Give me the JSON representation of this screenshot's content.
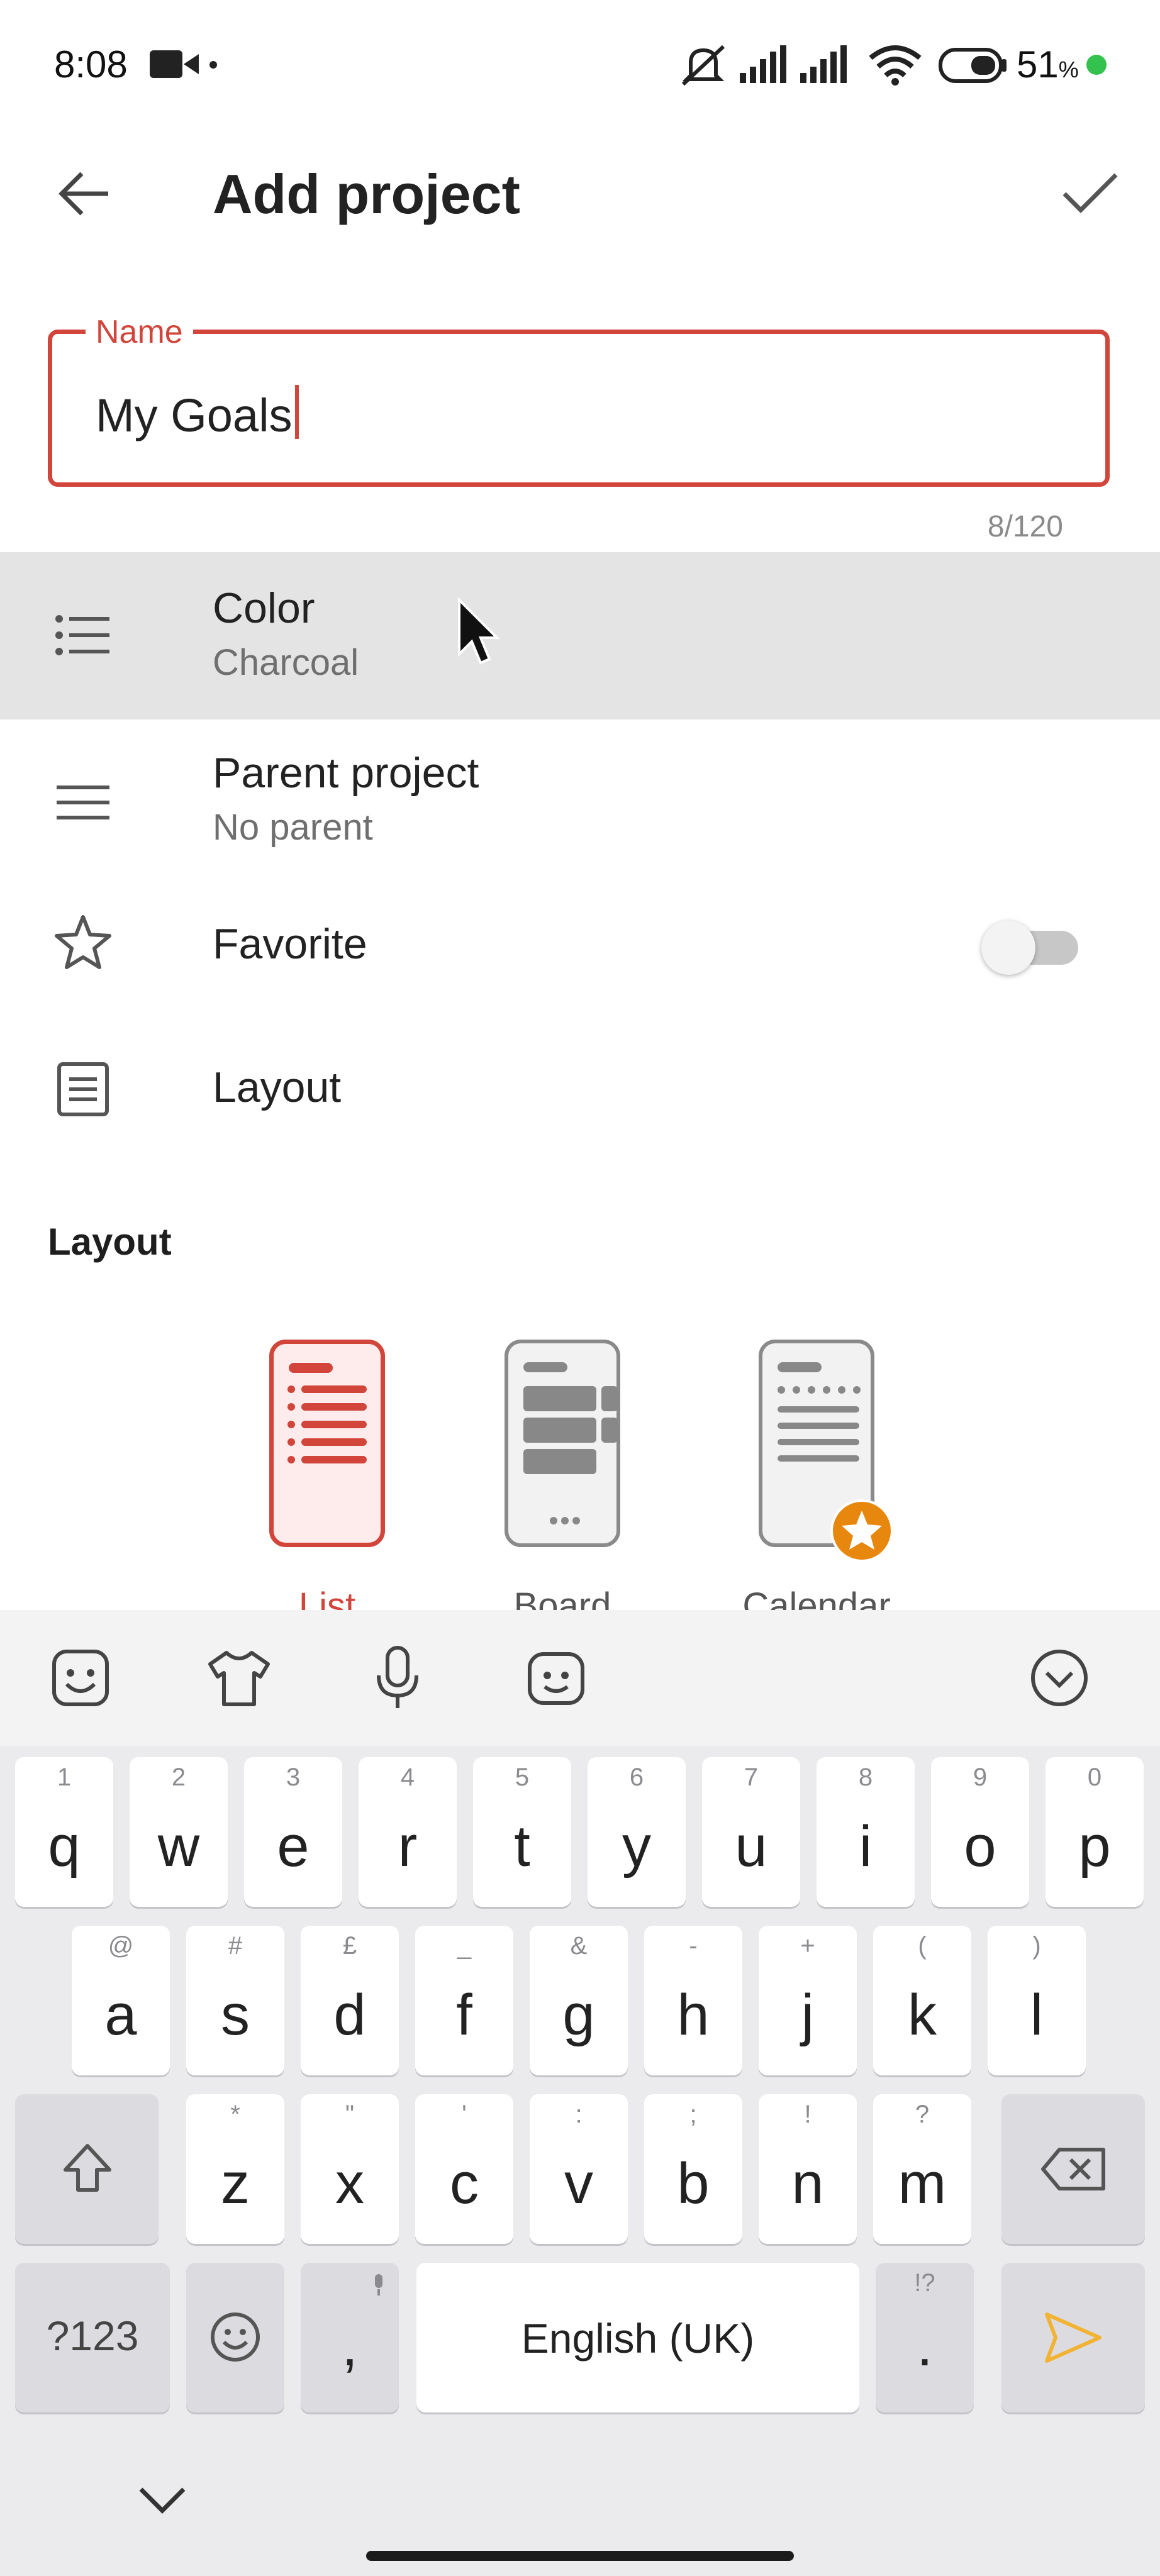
{
  "status_bar": {
    "time": "8:08",
    "battery_percent": "51",
    "percent_sign": "%",
    "battery_level": 51,
    "icons": [
      "video-camera-icon",
      "dot-icon",
      "mute-bell-icon",
      "signal-icon",
      "signal-icon",
      "wifi-icon",
      "battery-icon",
      "charging-dot-icon"
    ]
  },
  "header": {
    "title": "Add project",
    "back_icon": "arrow-left-icon",
    "confirm_icon": "checkmark-icon"
  },
  "name_field": {
    "label": "Name",
    "value": "My Goals",
    "counter": "8/120"
  },
  "settings": {
    "color": {
      "label": "Color",
      "value": "Charcoal",
      "icon": "list-dots-icon"
    },
    "parent": {
      "label": "Parent project",
      "value": "No parent",
      "icon": "lines-icon"
    },
    "favorite": {
      "label": "Favorite",
      "icon": "star-outline-icon",
      "enabled": false
    },
    "layout": {
      "label": "Layout",
      "icon": "document-icon"
    }
  },
  "layout_section": {
    "heading": "Layout",
    "options": [
      {
        "label": "List",
        "selected": true
      },
      {
        "label": "Board",
        "selected": false
      },
      {
        "label": "Calendar",
        "selected": false,
        "badge": "star-badge-icon"
      }
    ]
  },
  "colors": {
    "accent": "#d1453b",
    "badge": "#e8870e",
    "send_arrow": "#f2b233"
  },
  "keyboard": {
    "toolbar_icons": [
      "emoji-sticker-icon",
      "shirt-icon",
      "microphone-icon",
      "face-icon",
      "collapse-keyboard-icon"
    ],
    "row1": [
      {
        "k": "q",
        "h": "1"
      },
      {
        "k": "w",
        "h": "2"
      },
      {
        "k": "e",
        "h": "3"
      },
      {
        "k": "r",
        "h": "4"
      },
      {
        "k": "t",
        "h": "5"
      },
      {
        "k": "y",
        "h": "6"
      },
      {
        "k": "u",
        "h": "7"
      },
      {
        "k": "i",
        "h": "8"
      },
      {
        "k": "o",
        "h": "9"
      },
      {
        "k": "p",
        "h": "0"
      }
    ],
    "row2": [
      {
        "k": "a",
        "h": "@"
      },
      {
        "k": "s",
        "h": "#"
      },
      {
        "k": "d",
        "h": "£"
      },
      {
        "k": "f",
        "h": "_"
      },
      {
        "k": "g",
        "h": "&"
      },
      {
        "k": "h",
        "h": "-"
      },
      {
        "k": "j",
        "h": "+"
      },
      {
        "k": "k",
        "h": "("
      },
      {
        "k": "l",
        "h": ")"
      }
    ],
    "row3": [
      {
        "k": "z",
        "h": "*"
      },
      {
        "k": "x",
        "h": "\""
      },
      {
        "k": "c",
        "h": "'"
      },
      {
        "k": "v",
        "h": ":"
      },
      {
        "k": "b",
        "h": ";"
      },
      {
        "k": "n",
        "h": "!"
      },
      {
        "k": "m",
        "h": "?"
      }
    ],
    "symbols_key": "?123",
    "comma_key": ",",
    "space_label": "English (UK)",
    "period_key": ".",
    "period_hint": "!?"
  }
}
